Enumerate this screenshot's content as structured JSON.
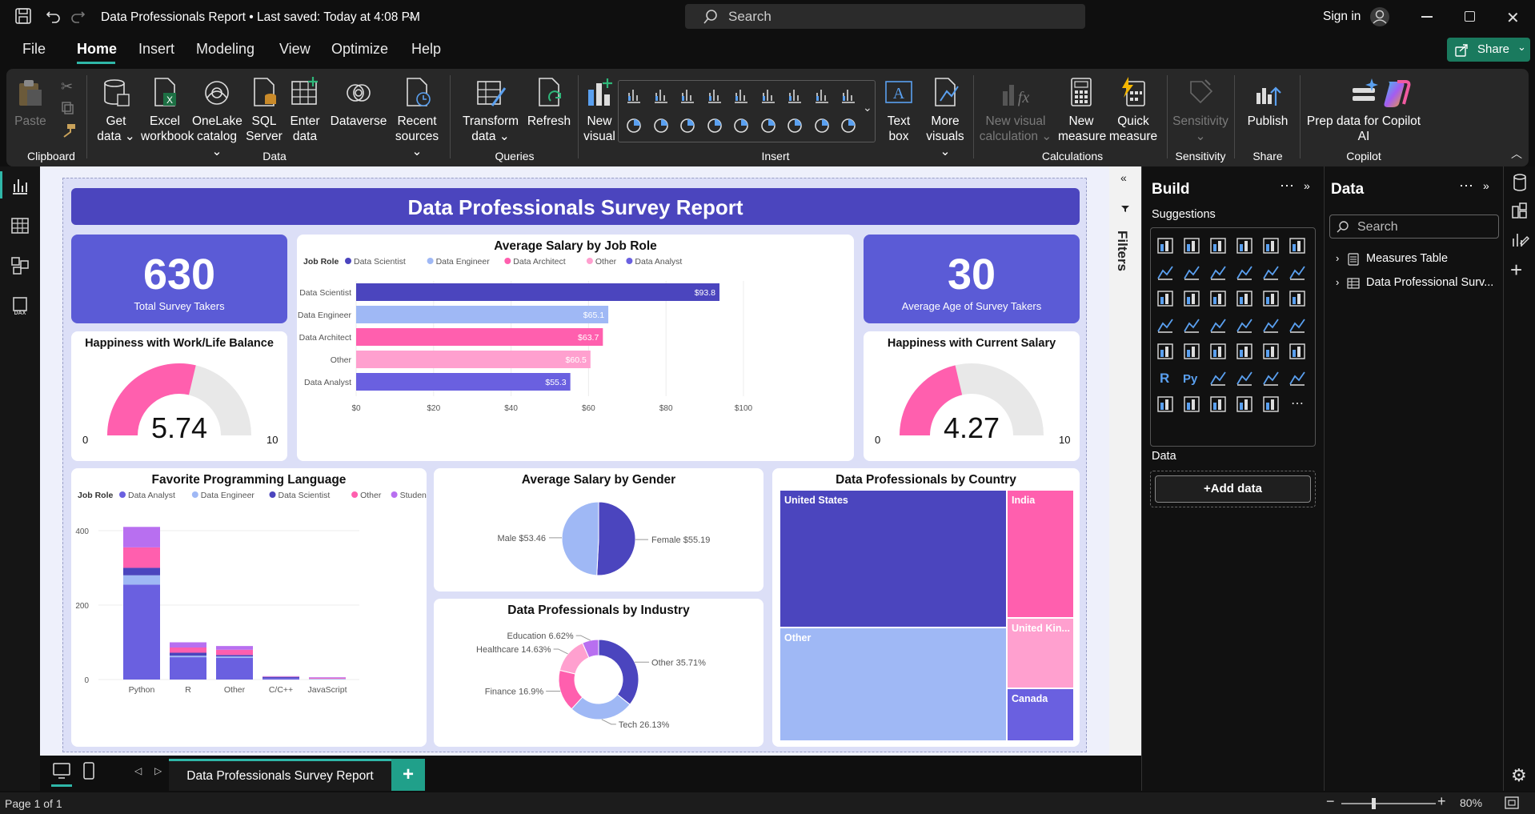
{
  "titlebar": {
    "title": "Data Professionals Report",
    "saved": "Last saved: Today at 4:08 PM",
    "search_placeholder": "Search",
    "sign_in": "Sign in"
  },
  "menu": {
    "items": [
      "File",
      "Home",
      "Insert",
      "Modeling",
      "View",
      "Optimize",
      "Help"
    ],
    "share": "Share"
  },
  "ribbon": {
    "clipboard": {
      "paste": "Paste",
      "group": "Clipboard"
    },
    "data": {
      "get_data_1": "Get",
      "get_data_2": "data",
      "excel_1": "Excel",
      "excel_2": "workbook",
      "onelake_1": "OneLake",
      "onelake_2": "catalog",
      "sql_1": "SQL",
      "sql_2": "Server",
      "enter_1": "Enter",
      "enter_2": "data",
      "dataverse": "Dataverse",
      "recent_1": "Recent",
      "recent_2": "sources",
      "group": "Data"
    },
    "queries": {
      "transform_1": "Transform",
      "transform_2": "data",
      "refresh": "Refresh",
      "group": "Queries"
    },
    "insert": {
      "new_visual_1": "New",
      "new_visual_2": "visual",
      "text_box_1": "Text",
      "text_box_2": "box",
      "more_visuals_1": "More",
      "more_visuals_2": "visuals",
      "group": "Insert"
    },
    "calculations": {
      "new_visual_calc_1": "New visual",
      "new_visual_calc_2": "calculation",
      "new_measure_1": "New",
      "new_measure_2": "measure",
      "quick_measure_1": "Quick",
      "quick_measure_2": "measure",
      "group": "Calculations"
    },
    "sensitivity": {
      "label": "Sensitivity",
      "group": "Sensitivity"
    },
    "share": {
      "publish": "Publish",
      "group": "Share"
    },
    "copilot": {
      "prep_1": "Prep data for Copilot",
      "prep_2": "AI",
      "group": "Copilot"
    }
  },
  "report": {
    "title": "Data Professionals Survey Report",
    "kpi_total": {
      "value": "630",
      "label": "Total Survey Takers"
    },
    "kpi_age": {
      "value": "30",
      "label": "Average Age of Survey Takers"
    },
    "gauge_worklife": {
      "title": "Happiness with Work/Life Balance",
      "value": "5.74",
      "min": "0",
      "max": "10",
      "fraction": 0.574
    },
    "gauge_salary": {
      "title": "Happiness with Current Salary",
      "value": "4.27",
      "min": "0",
      "max": "10",
      "fraction": 0.427
    }
  },
  "chart_data": [
    {
      "type": "bar",
      "orientation": "horizontal",
      "title": "Average Salary by Job Role",
      "legend_title": "Job Role",
      "legend": [
        "Data Scientist",
        "Data Engineer",
        "Data Architect",
        "Other",
        "Data Analyst"
      ],
      "categories": [
        "Data Scientist",
        "Data Engineer",
        "Data Architect",
        "Other",
        "Data Analyst"
      ],
      "values": [
        93.8,
        65.1,
        63.7,
        60.5,
        55.3
      ],
      "data_labels": [
        "$93.8",
        "$65.1",
        "$63.7",
        "$60.5",
        "$55.3"
      ],
      "colors": [
        "#4b45be",
        "#9fb8f5",
        "#ff5fae",
        "#ffa0cf",
        "#6a60e0"
      ],
      "xticks": [
        "$0",
        "$20",
        "$40",
        "$60",
        "$80",
        "$100"
      ],
      "xlim": [
        0,
        100
      ]
    },
    {
      "type": "bar",
      "stacked": true,
      "title": "Favorite Programming Language",
      "legend_title": "Job Role",
      "legend": [
        "Data Analyst",
        "Data Engineer",
        "Data Scientist",
        "Other",
        "Student/Lookin..."
      ],
      "categories": [
        "Python",
        "R",
        "Other",
        "C/C++",
        "JavaScript"
      ],
      "series": [
        {
          "name": "Data Analyst",
          "color": "#6a60e0",
          "values": [
            255,
            60,
            58,
            4,
            0
          ]
        },
        {
          "name": "Data Engineer",
          "color": "#9fb8f5",
          "values": [
            25,
            4,
            4,
            0,
            2
          ]
        },
        {
          "name": "Data Scientist",
          "color": "#4b45be",
          "values": [
            20,
            8,
            4,
            3,
            0
          ]
        },
        {
          "name": "Other",
          "color": "#ff5fae",
          "values": [
            55,
            14,
            14,
            1,
            2
          ]
        },
        {
          "name": "Student/Lookin...",
          "color": "#b86ff0",
          "values": [
            55,
            14,
            10,
            1,
            2
          ]
        }
      ],
      "yticks": [
        "0",
        "200",
        "400"
      ],
      "ylim": [
        0,
        430
      ]
    },
    {
      "type": "pie",
      "title": "Average Salary by Gender",
      "labels": [
        "Female $55.19",
        "Male $53.46"
      ],
      "categories": [
        "Female",
        "Male"
      ],
      "values": [
        55.19,
        53.46
      ],
      "colors": [
        "#4b45be",
        "#9fb8f5"
      ]
    },
    {
      "type": "pie",
      "donut": true,
      "title": "Data Professionals by Industry",
      "categories": [
        "Other",
        "Tech",
        "Finance",
        "Healthcare",
        "Education"
      ],
      "values": [
        35.71,
        26.13,
        16.9,
        14.63,
        6.62
      ],
      "labels": [
        "Other 35.71%",
        "Tech 26.13%",
        "Finance 16.9%",
        "Healthcare 14.63%",
        "Education 6.62%"
      ],
      "colors": [
        "#4b45be",
        "#9fb8f5",
        "#ff5fae",
        "#ffa0cf",
        "#b86ff0"
      ]
    },
    {
      "type": "treemap",
      "title": "Data Professionals by Country",
      "categories": [
        "United States",
        "Other",
        "India",
        "United Kin...",
        "Canada"
      ],
      "colors": [
        "#4b45be",
        "#9fb8f5",
        "#ff5fae",
        "#ffa0cf",
        "#6a60e0"
      ]
    }
  ],
  "filters": {
    "label": "Filters"
  },
  "build": {
    "title": "Build",
    "suggestions": "Suggestions",
    "data_label": "Data",
    "add_data": "+Add data"
  },
  "data_pane": {
    "title": "Data",
    "search_placeholder": "Search",
    "items": [
      "Measures Table",
      "Data Professional Surv..."
    ]
  },
  "pages": {
    "tab": "Data Professionals Survey Report",
    "add": "+"
  },
  "status": {
    "page": "Page 1 of 1",
    "zoom": "80%"
  }
}
